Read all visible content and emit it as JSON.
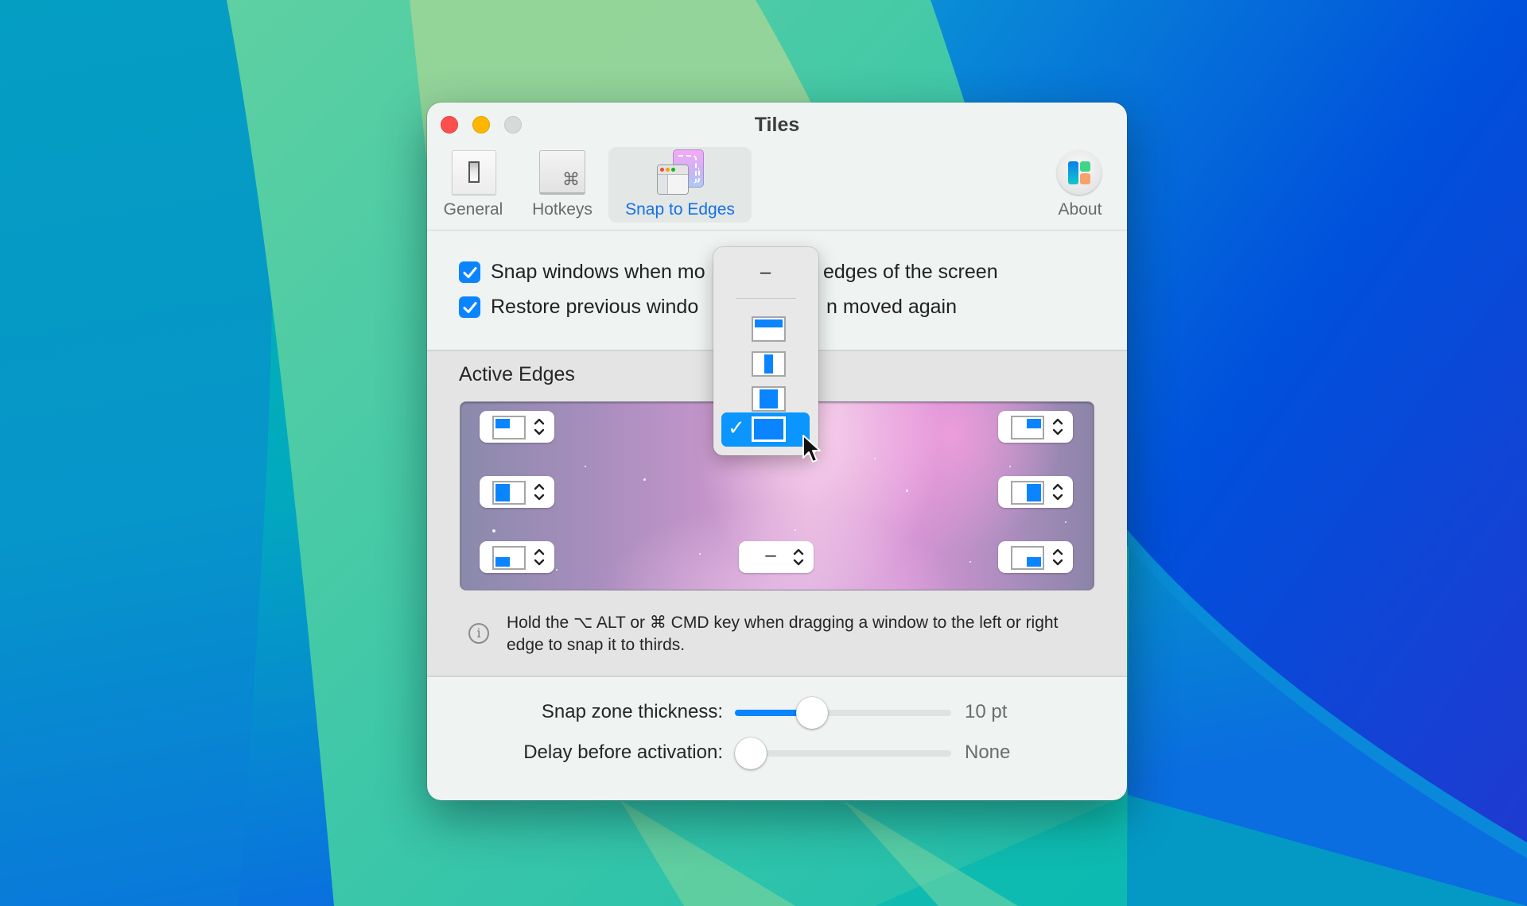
{
  "window": {
    "title": "Tiles",
    "traffic_lights": [
      "close",
      "minimize",
      "zoom-disabled"
    ]
  },
  "toolbar": {
    "tabs": [
      {
        "id": "general",
        "label": "General",
        "icon": "switch-icon",
        "selected": false
      },
      {
        "id": "hotkeys",
        "label": "Hotkeys",
        "icon": "command-key-icon",
        "selected": false
      },
      {
        "id": "snap",
        "label": "Snap to Edges",
        "icon": "snap-window-icon",
        "selected": true
      },
      {
        "id": "about",
        "label": "About",
        "icon": "tiles-app-icon",
        "selected": false
      }
    ],
    "command_glyph": "⌘"
  },
  "options": {
    "snap_windows": {
      "label": "Snap windows when moved to edges of the screen",
      "visible_left": "Snap windows when mo",
      "visible_right": "edges of the screen",
      "checked": true
    },
    "restore_size": {
      "label": "Restore previous window size when moved again",
      "visible_left": "Restore previous windo",
      "visible_right": "n moved again",
      "checked": true
    }
  },
  "active_edges": {
    "title": "Active Edges",
    "edges": {
      "top_left": {
        "layout": "top-left-quarter"
      },
      "top_center": {
        "layout": "full",
        "menu_open": true
      },
      "top_right": {
        "layout": "top-right-quarter"
      },
      "left": {
        "layout": "left-half"
      },
      "right": {
        "layout": "right-half"
      },
      "bottom_left": {
        "layout": "bottom-left-quarter"
      },
      "bottom_center": {
        "layout": "none",
        "value_text": "–"
      },
      "bottom_right": {
        "layout": "bottom-right-quarter"
      }
    },
    "info_icon": "info-circle-icon",
    "info_glyph": "i",
    "info_text": "Hold the ⌥ ALT or ⌘ CMD key when dragging a window to the left or right edge to snap it to thirds."
  },
  "dropdown_menu": {
    "none_label": "–",
    "items": [
      {
        "layout": "top-half",
        "selected": false
      },
      {
        "layout": "center-third",
        "selected": false
      },
      {
        "layout": "center",
        "selected": false
      },
      {
        "layout": "full",
        "selected": true
      }
    ],
    "check_glyph": "✓"
  },
  "sliders": {
    "snap_zone": {
      "label": "Snap zone thickness:",
      "value_text": "10 pt",
      "fraction": 0.33
    },
    "delay": {
      "label": "Delay before activation:",
      "value_text": "None",
      "fraction": 0.0
    }
  },
  "colors": {
    "accent": "#0a84ff",
    "selected_tab_text": "#1570e8",
    "close": "#fe4f4f",
    "minimize": "#fdb700"
  }
}
